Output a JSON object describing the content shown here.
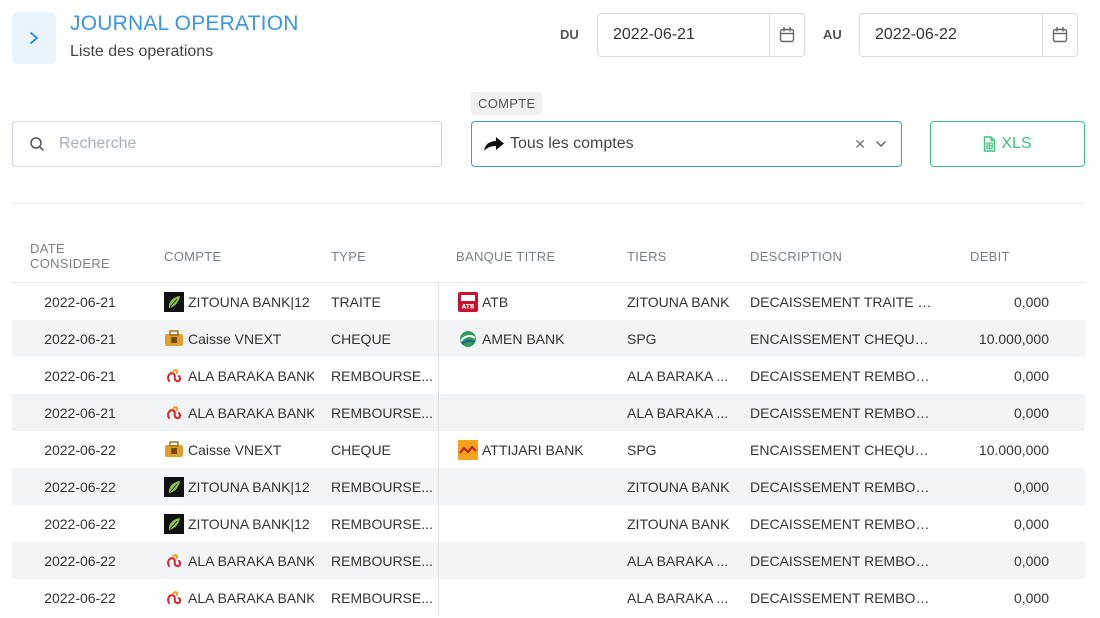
{
  "header": {
    "title": "JOURNAL OPERATION",
    "subtitle": "Liste des operations",
    "toggle_icon": "chevron-right-icon"
  },
  "date_range": {
    "from_label": "DU",
    "from_value": "2022-06-21",
    "to_label": "AU",
    "to_value": "2022-06-22"
  },
  "search": {
    "placeholder": "Recherche"
  },
  "compte": {
    "label": "COMPTE",
    "value": "Tous les comptes"
  },
  "export": {
    "label": "XLS"
  },
  "table": {
    "columns": [
      "DATE CONSIDERE",
      "COMPTE",
      "TYPE",
      "BANQUE TITRE",
      "TIERS",
      "DESCRIPTION",
      "DEBIT"
    ],
    "rows": [
      {
        "date": "2022-06-21",
        "compte": "ZITOUNA BANK|12",
        "compte_logo": "zitouna",
        "type": "TRAITE",
        "banque": "ATB",
        "banque_logo": "atb",
        "tiers": "ZITOUNA BANK",
        "description": "DECAISSEMENT TRAITE (EN ...",
        "debit": "0,000"
      },
      {
        "date": "2022-06-21",
        "compte": "Caisse VNEXT",
        "compte_logo": "caisse",
        "type": "CHEQUE",
        "banque": "AMEN BANK",
        "banque_logo": "amen",
        "tiers": "SPG",
        "description": "ENCAISSEMENT CHEQUE (E...",
        "debit": "10.000,000"
      },
      {
        "date": "2022-06-21",
        "compte": "ALA BARAKA BANK",
        "compte_logo": "baraka",
        "type": "REMBOURSE...",
        "banque": "",
        "banque_logo": "",
        "tiers": "ALA BARAKA ...",
        "description": "DECAISSEMENT REMBOURS...",
        "debit": "0,000"
      },
      {
        "date": "2022-06-21",
        "compte": "ALA BARAKA BANK",
        "compte_logo": "baraka",
        "type": "REMBOURSE...",
        "banque": "",
        "banque_logo": "",
        "tiers": "ALA BARAKA ...",
        "description": "DECAISSEMENT REMBOURS...",
        "debit": "0,000"
      },
      {
        "date": "2022-06-22",
        "compte": "Caisse VNEXT",
        "compte_logo": "caisse",
        "type": "CHEQUE",
        "banque": "ATTIJARI BANK",
        "banque_logo": "attijari",
        "tiers": "SPG",
        "description": "ENCAISSEMENT CHEQUE (RE...",
        "debit": "10.000,000"
      },
      {
        "date": "2022-06-22",
        "compte": "ZITOUNA BANK|12",
        "compte_logo": "zitouna",
        "type": "REMBOURSE...",
        "banque": "",
        "banque_logo": "",
        "tiers": "ZITOUNA BANK",
        "description": "DECAISSEMENT REMBOURS...",
        "debit": "0,000"
      },
      {
        "date": "2022-06-22",
        "compte": "ZITOUNA BANK|12",
        "compte_logo": "zitouna",
        "type": "REMBOURSE...",
        "banque": "",
        "banque_logo": "",
        "tiers": "ZITOUNA BANK",
        "description": "DECAISSEMENT REMBOURS...",
        "debit": "0,000"
      },
      {
        "date": "2022-06-22",
        "compte": "ALA BARAKA BANK",
        "compte_logo": "baraka",
        "type": "REMBOURSE...",
        "banque": "",
        "banque_logo": "",
        "tiers": "ALA BARAKA ...",
        "description": "DECAISSEMENT REMBOURS...",
        "debit": "0,000"
      },
      {
        "date": "2022-06-22",
        "compte": "ALA BARAKA BANK",
        "compte_logo": "baraka",
        "type": "REMBOURSE...",
        "banque": "",
        "banque_logo": "",
        "tiers": "ALA BARAKA ...",
        "description": "DECAISSEMENT REMBOURS...",
        "debit": "0,000"
      }
    ]
  },
  "colors": {
    "accent": "#3c96e8",
    "success": "#3ac47d"
  }
}
